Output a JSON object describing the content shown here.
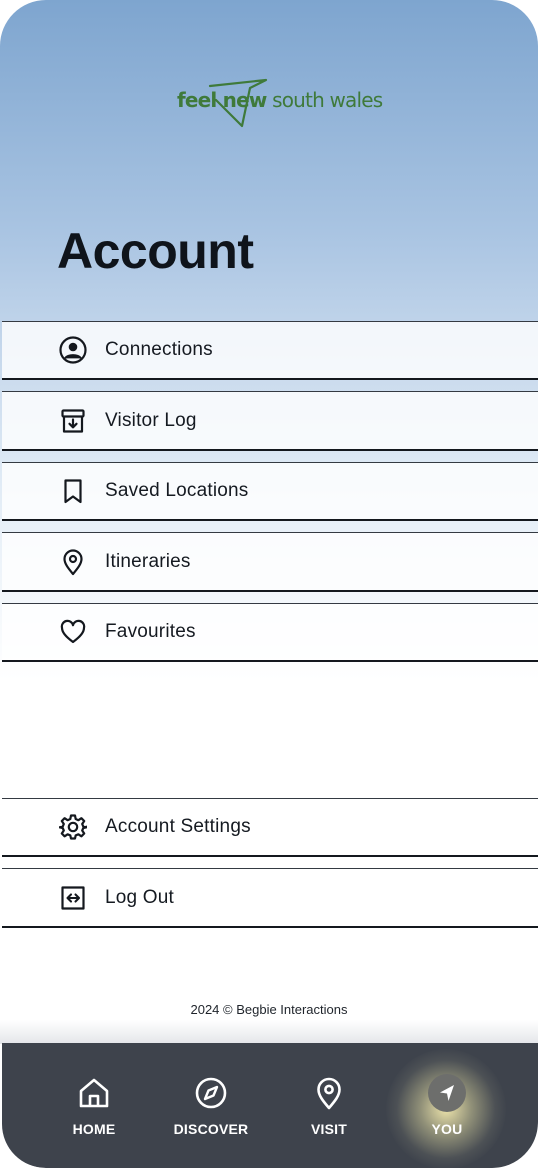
{
  "brand": {
    "logo_text_bold": "feel new",
    "logo_text_regular": " south wales",
    "colors": {
      "logo_green": "#3f7a3a",
      "nav_bg": "#3e434c",
      "title": "#0f141b"
    }
  },
  "page": {
    "title": "Account"
  },
  "menu": {
    "items": [
      {
        "label": "Connections",
        "icon": "user-circle-icon"
      },
      {
        "label": "Visitor Log",
        "icon": "archive-download-icon"
      },
      {
        "label": "Saved Locations",
        "icon": "bookmark-icon"
      },
      {
        "label": "Itineraries",
        "icon": "location-pin-icon"
      },
      {
        "label": "Favourites",
        "icon": "heart-icon"
      }
    ]
  },
  "settings": {
    "items": [
      {
        "label": "Account Settings",
        "icon": "gear-icon"
      },
      {
        "label": "Log Out",
        "icon": "logout-icon"
      }
    ]
  },
  "footer": {
    "copyright": "2024 © Begbie Interactions"
  },
  "nav": {
    "items": [
      {
        "label": "HOME",
        "icon": "home-icon"
      },
      {
        "label": "DISCOVER",
        "icon": "compass-icon"
      },
      {
        "label": "VISIT",
        "icon": "location-pin-icon"
      },
      {
        "label": "YOU",
        "icon": "navigation-arrow-icon",
        "active": true
      }
    ]
  }
}
